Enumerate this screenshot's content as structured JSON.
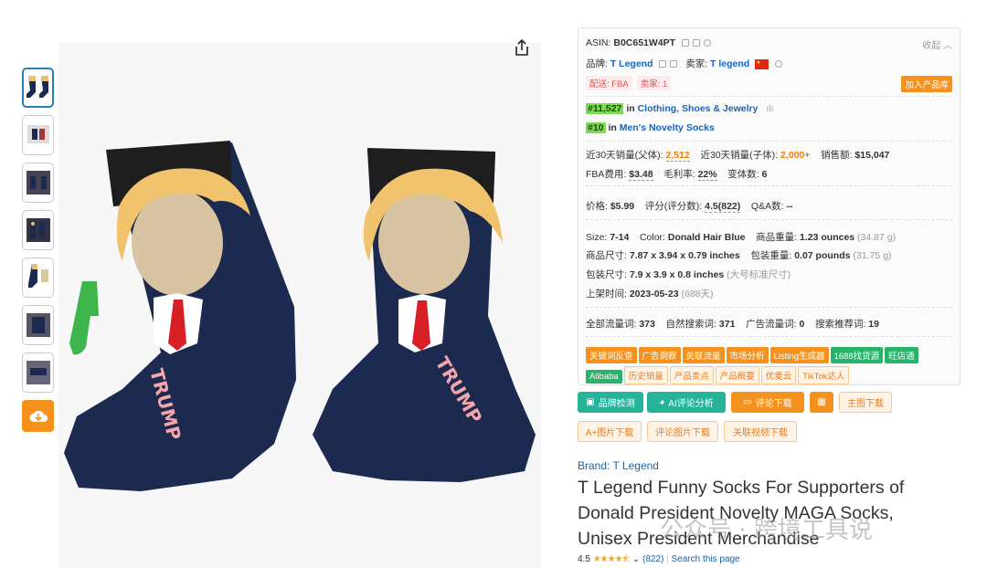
{
  "panel": {
    "asin_label": "ASIN:",
    "asin": "B0C651W4PT",
    "collapse": "收起",
    "brand_label": "品牌:",
    "brand": "T Legend",
    "seller_label": "卖家:",
    "seller": "T legend",
    "tag_fba": "配送: FBA",
    "tag_sellers": "卖家: 1",
    "add_button": "加入产品库",
    "rank1": "#11,527",
    "rank1_in": "in",
    "rank1_cat": "Clothing, Shoes & Jewelry",
    "rank2": "#10",
    "rank2_in": "in",
    "rank2_cat": "Men's Novelty Socks",
    "sales_parent_label": "近30天销量(父体):",
    "sales_parent": "2,512",
    "sales_child_label": "近30天销量(子体):",
    "sales_child": "2,000+",
    "revenue_label": "销售额:",
    "revenue": "$15,047",
    "fba_fee_label": "FBA费用:",
    "fba_fee": "$3.48",
    "margin_label": "毛利率:",
    "margin": "22%",
    "variants_label": "变体数:",
    "variants": "6",
    "price_label": "价格:",
    "price": "$5.99",
    "rating_label": "评分(评分数):",
    "rating": "4.5(822)",
    "qa_label": "Q&A数:",
    "qa": "--",
    "size_label": "Size:",
    "size": "7-14",
    "color_label": "Color:",
    "color": "Donald Hair Blue",
    "weight_label": "商品重量:",
    "weight": "1.23 ounces",
    "weight_g": "(34.87 g)",
    "dims_label": "商品尺寸:",
    "dims": "7.87 x 3.94 x 0.79 inches",
    "pkg_weight_label": "包装重量:",
    "pkg_weight": "0.07 pounds",
    "pkg_weight_g": "(31.75 g)",
    "pkg_dims_label": "包装尺寸:",
    "pkg_dims": "7.9 x 3.9 x 0.8 inches",
    "pkg_dims_type": "(大号标准尺寸)",
    "listed_label": "上架时间:",
    "listed": "2023-05-23",
    "listed_days": "(688天)",
    "traffic_all_label": "全部流量词:",
    "traffic_all": "373",
    "organic_label": "自然搜索词:",
    "organic": "371",
    "ads_label": "广告流量词:",
    "ads": "0",
    "recommend_label": "搜索推荐词:",
    "recommend": "19",
    "tags_row1": [
      "关键词反查",
      "广告洞察",
      "关联流量",
      "市场分析",
      "Listing生成器"
    ],
    "tag_1688": "1688找货源",
    "tag_wang": "旺店通",
    "tag_alibaba": "Alibaba",
    "tags_row2": [
      "历史销量",
      "产品卖点",
      "产品概要",
      "优麦云",
      "TikTok达人"
    ]
  },
  "actions": {
    "brand_check": "品牌检测",
    "ai_review": "AI评论分析",
    "review_download": "评论下载",
    "main_image_download": "主图下载",
    "aplus_download": "A+图片下载",
    "review_images_download": "评论图片下载",
    "video_download": "关联视频下载"
  },
  "product": {
    "brand_link": "Brand: T Legend",
    "title": "T Legend Funny Socks For Supporters of Donald President Novelty MAGA Socks, Unisex President Merchandise",
    "rating_value": "4.5",
    "rating_count": "(822)",
    "search_link": "Search this page"
  },
  "watermark": "公众号 · 跨境工具说",
  "colors": {
    "accent_orange": "#f5921e",
    "accent_green": "#26b39a",
    "link_blue": "#2162a1",
    "sock_navy": "#1b2a4e"
  }
}
